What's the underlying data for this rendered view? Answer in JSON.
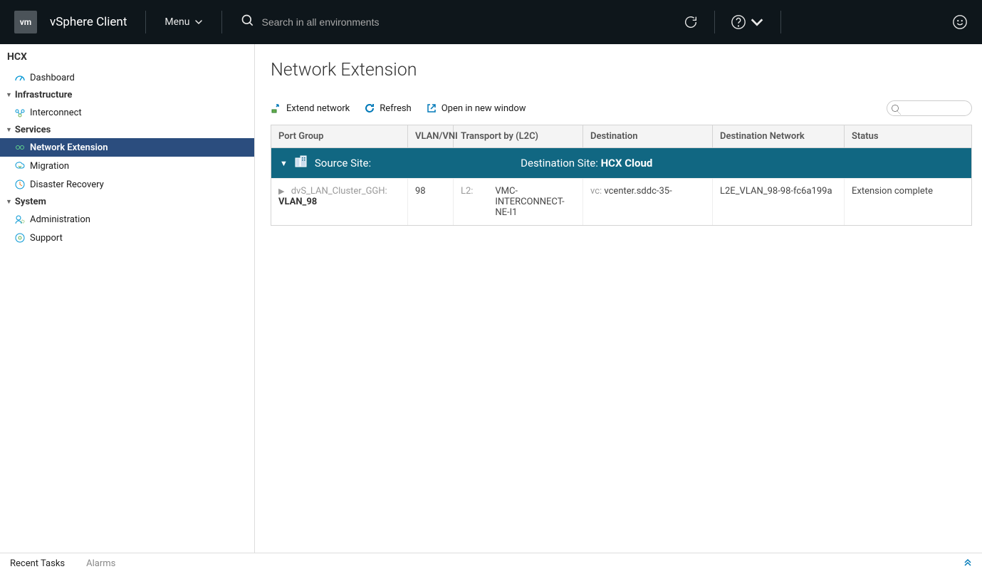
{
  "header": {
    "logo_text": "vm",
    "app": "vSphere Client",
    "menu_label": "Menu",
    "search_placeholder": "Search in all environments"
  },
  "sidebar": {
    "root": "HCX",
    "nodes": [
      {
        "type": "item",
        "label": "Dashboard",
        "icon": "gauge"
      },
      {
        "type": "group",
        "label": "Infrastructure"
      },
      {
        "type": "item",
        "label": "Interconnect",
        "icon": "interconnect"
      },
      {
        "type": "group",
        "label": "Services"
      },
      {
        "type": "item",
        "label": "Network Extension",
        "icon": "net-ext",
        "selected": true
      },
      {
        "type": "item",
        "label": "Migration",
        "icon": "migration"
      },
      {
        "type": "item",
        "label": "Disaster Recovery",
        "icon": "dr"
      },
      {
        "type": "group",
        "label": "System"
      },
      {
        "type": "item",
        "label": "Administration",
        "icon": "admin"
      },
      {
        "type": "item",
        "label": "Support",
        "icon": "support"
      }
    ]
  },
  "page": {
    "title": "Network Extension",
    "toolbar": {
      "extend": "Extend network",
      "refresh": "Refresh",
      "open_new": "Open in new window"
    },
    "columns": {
      "port_group": "Port Group",
      "vlan": "VLAN/VNI",
      "l2c": "Transport by (L2C)",
      "dest": "Destination",
      "dest_net": "Destination Network",
      "status": "Status"
    },
    "group": {
      "src_label": "Source Site:",
      "dst_label": "Destination Site:",
      "dst_value": "HCX Cloud"
    },
    "rows": [
      {
        "pg_prefix": "dvS_LAN_Cluster_GGH:",
        "pg_name": "VLAN_98",
        "vlan": "98",
        "l2c_prefix": "L2:",
        "l2c_name": "VMC-INTERCONNECT-NE-I1",
        "dest_prefix": "vc:",
        "dest_name": "vcenter.sddc-35-",
        "dest_net": "L2E_VLAN_98-98-fc6a199a",
        "status": "Extension complete"
      }
    ]
  },
  "bottom": {
    "recent": "Recent Tasks",
    "alarms": "Alarms"
  }
}
